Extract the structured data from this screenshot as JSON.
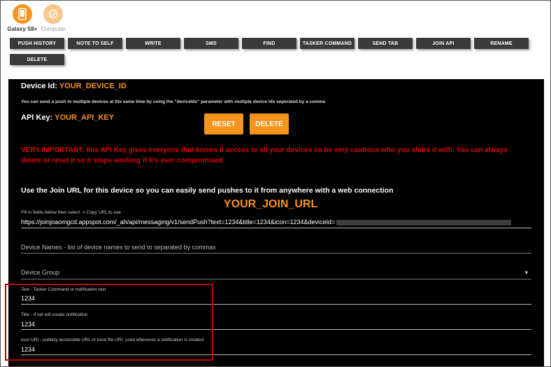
{
  "devices": [
    {
      "name": "Galaxy S8+",
      "icon": "phone-icon",
      "active": true
    },
    {
      "name": "Computer",
      "icon": "computer-icon",
      "active": false
    }
  ],
  "actions": [
    "PUSH HISTORY",
    "NOTE TO SELF",
    "WRITE",
    "SMS",
    "FIND",
    "TASKER COMMAND",
    "SEND TAB",
    "JOIN API",
    "RENAME",
    "DELETE"
  ],
  "panel": {
    "device_id_label": "Device Id:",
    "device_id_value": "YOUR_DEVICE_ID",
    "multi_note": "You can send a push to multiple devices at the same time by using the \"deviceIds\" parameter with multiple device Ids seperated by a comma",
    "api_key_label": "API Key:",
    "api_key_value": "YOUR_API_KEY",
    "reset_label": "RESET",
    "delete_label": "DELETE",
    "warning": "VERY IMPORTANT: this API Key gives everyone that knows it access to all your devices so be very cautious who you share it with. You can always delete or reset it so it stops working if it's ever compromised.",
    "join_url_heading": "Use the Join URL for this device so you can easily send pushes to it from anywhere with a web connection",
    "join_url_overlay": "YOUR_JOIN_URL",
    "fill_hint": "Fill in fields below then select -> Copy URL to use",
    "url_value": "https://joinjoaomgcd.appspot.com/_ah/api/messaging/v1/sendPush?text=1234&title=1234&icon=1234&deviceId=",
    "device_names_placeholder": "Device Names - list of device names to send to separated by commas",
    "device_group_label": "Device Group",
    "fields": [
      {
        "label": "Text - Tasker Command or notification text",
        "value": "1234"
      },
      {
        "label": "Title - If set will create notification",
        "value": "1234"
      },
      {
        "label": "Icon URI - publicly accessible URL or local file URI; used whenever a notification is created",
        "value": "1234"
      }
    ]
  },
  "colors": {
    "accent": "#f7941d",
    "warning": "#e00000",
    "highlight_box": "#c00000"
  }
}
